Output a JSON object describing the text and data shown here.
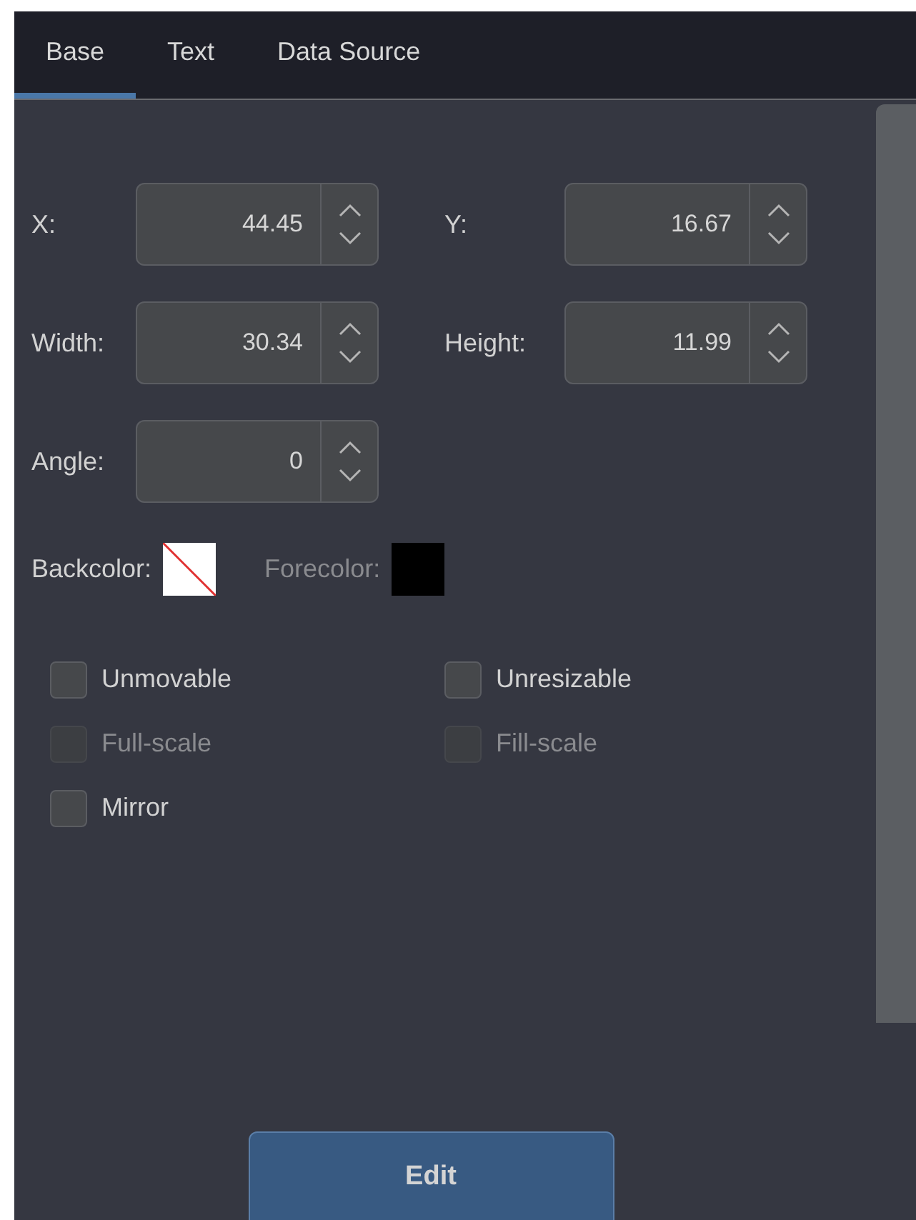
{
  "tabs": [
    {
      "label": "Base",
      "selected": true
    },
    {
      "label": "Text",
      "selected": false
    },
    {
      "label": "Data Source",
      "selected": false
    }
  ],
  "fields": [
    [
      {
        "label": "X:",
        "value": "44.45"
      },
      {
        "label": "Y:",
        "value": "16.67"
      }
    ],
    [
      {
        "label": "Width:",
        "value": "30.34"
      },
      {
        "label": "Height:",
        "value": "11.99"
      }
    ],
    [
      {
        "label": "Angle:",
        "value": "0"
      }
    ]
  ],
  "colors": [
    {
      "label": "Backcolor:",
      "kind": "none",
      "disabled": false
    },
    {
      "label": "Forecolor:",
      "kind": "swatch",
      "color": "#000000",
      "disabled": true
    }
  ],
  "options": [
    [
      {
        "label": "Unmovable",
        "checked": false,
        "disabled": false
      },
      {
        "label": "Unresizable",
        "checked": false,
        "disabled": false
      }
    ],
    [
      {
        "label": "Full-scale",
        "checked": false,
        "disabled": true
      },
      {
        "label": "Fill-scale",
        "checked": false,
        "disabled": true
      }
    ],
    [
      {
        "label": "Mirror",
        "checked": false,
        "disabled": false
      }
    ]
  ],
  "button": "Edit"
}
